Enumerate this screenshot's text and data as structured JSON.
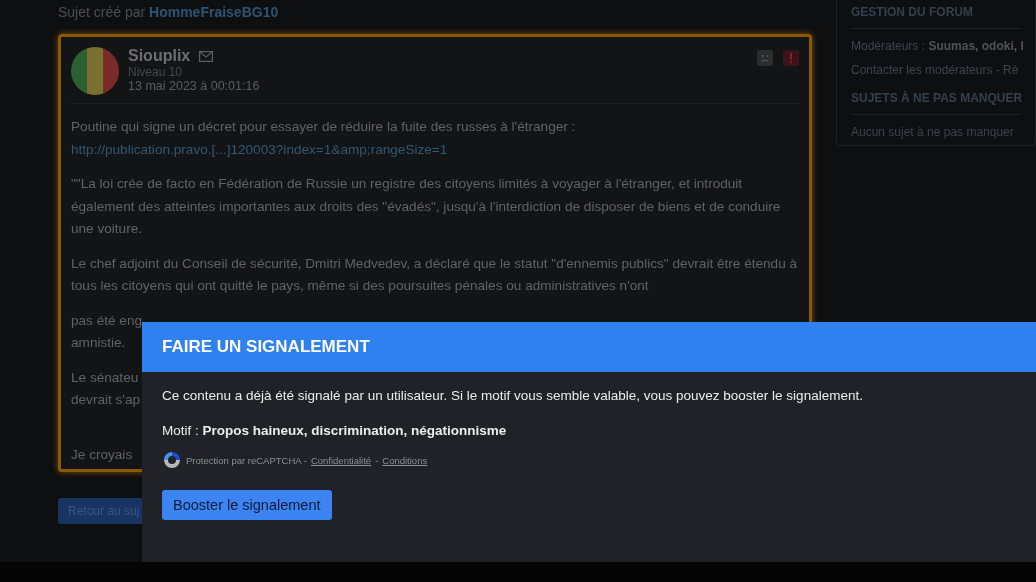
{
  "topic": {
    "label": "Sujet créé par",
    "author": "HommeFraiseBG10"
  },
  "post": {
    "author": "Siouplix",
    "level": "Niveau 10",
    "date": "13 mai 2023 à 00:01:16",
    "highlighted": true,
    "intro": "Poutine qui signe un décret pour essayer de réduire la fuite des russes à l'étranger :",
    "link": "http://publication.pravo.[...]120003?index=1&amp;rangeSize=1",
    "paragraphs": [
      "\"\"La loi crée de facto en Fédération de Russie un registre des citoyens limités à voyager à l'étranger, et introduit également des atteintes importantes aux droits des \"évadés\", jusqu'à l'interdiction de disposer de biens et de conduire une voiture.",
      "Le chef adjoint du Conseil de sécurité, Dmitri Medvedev, a déclaré que le statut \"d'ennemis publics\" devrait être étendu à tous les citoyens qui ont quitté le pays, même si des poursuites pénales ou administratives n'ont"
    ],
    "covered_fragments": [
      [
        "pas été eng",
        "amnistie."
      ],
      [
        "Le sénateu",
        "devrait s'ap"
      ],
      [
        "Je croyais"
      ]
    ]
  },
  "back_button": "Retour au suj",
  "sidebar": {
    "heading": "GESTION DU FORUM",
    "moderators_label": "Modérateurs :",
    "moderators": "Suumas, odoki, I",
    "contact": "Contacter les modérateurs - Rè",
    "section_heading": "SUJETS À NE PAS MANQUER",
    "empty_text": "Aucun sujet à ne pas manquer"
  },
  "modal": {
    "title": "FAIRE UN SIGNALEMENT",
    "message": "Ce contenu a déjà été signalé par un utilisateur. Si le motif vous semble valable, vous pouvez booster le signalement.",
    "reason_label": "Motif :",
    "reason": "Propos haineux, discrimination, négationnisme",
    "recaptcha_text": "Protection par reCAPTCHA -",
    "privacy_link": "Confidentialité",
    "separator": "-",
    "terms_link": "Conditions",
    "button": "Booster le signalement"
  }
}
